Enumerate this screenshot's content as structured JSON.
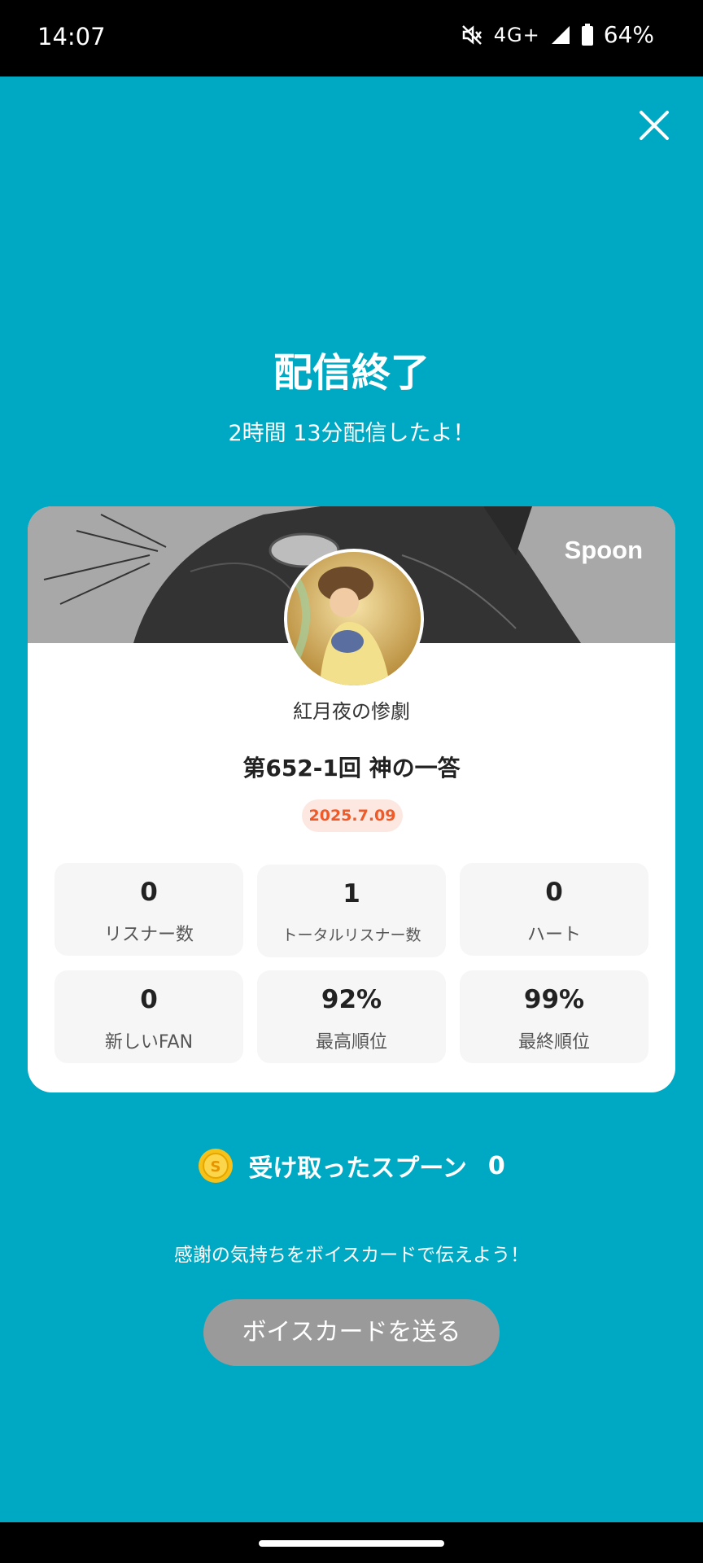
{
  "status_bar": {
    "time": "14:07",
    "network": "4G+",
    "battery": "64%",
    "icons": [
      "mute-icon",
      "signal-icon",
      "battery-icon"
    ]
  },
  "header": {
    "title": "配信終了",
    "subtitle": "2時間 13分配信したよ！"
  },
  "card": {
    "brand": "Spoon",
    "username": "紅月夜の惨劇",
    "episode_title": "第652-1回 神の一答",
    "date": "2025.7.09",
    "stats": [
      {
        "value": "0",
        "label": "リスナー数"
      },
      {
        "value": "1",
        "label": "トータルリスナー数"
      },
      {
        "value": "0",
        "label": "ハート"
      },
      {
        "value": "0",
        "label": "新しいFAN"
      },
      {
        "value": "92%",
        "label": "最高順位"
      },
      {
        "value": "99%",
        "label": "最終順位"
      }
    ]
  },
  "spoons": {
    "label": "受け取ったスプーン",
    "count": "0"
  },
  "thanks_message": "感謝の気持ちをボイスカードで伝えよう！",
  "voice_card_button": "ボイスカードを送る",
  "colors": {
    "background": "#00a9c3",
    "date_badge_text": "#f05a28",
    "button_disabled": "#9a9a9a"
  }
}
